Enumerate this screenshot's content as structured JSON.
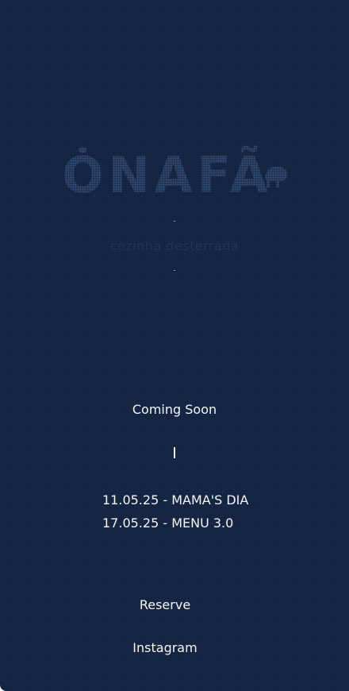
{
  "brand": {
    "logo_text": "ONAFÃ",
    "tagline": "cozinha desterrada"
  },
  "main": {
    "coming_soon": "Coming Soon",
    "divider": "|",
    "events": [
      {
        "date": "11.05.25",
        "label": "MAMA'S DIA",
        "text": "11.05.25 - MAMA'S DIA"
      },
      {
        "date": "17.05.25",
        "label": "MENU 3.0",
        "text": "17.05.25 - MENU 3.0"
      }
    ]
  },
  "nav": {
    "reserve_label": "Reserve",
    "instagram_label": "Instagram"
  },
  "colors": {
    "background": "#142543",
    "text": "#f3f5f8",
    "logo": "#2e4466"
  }
}
